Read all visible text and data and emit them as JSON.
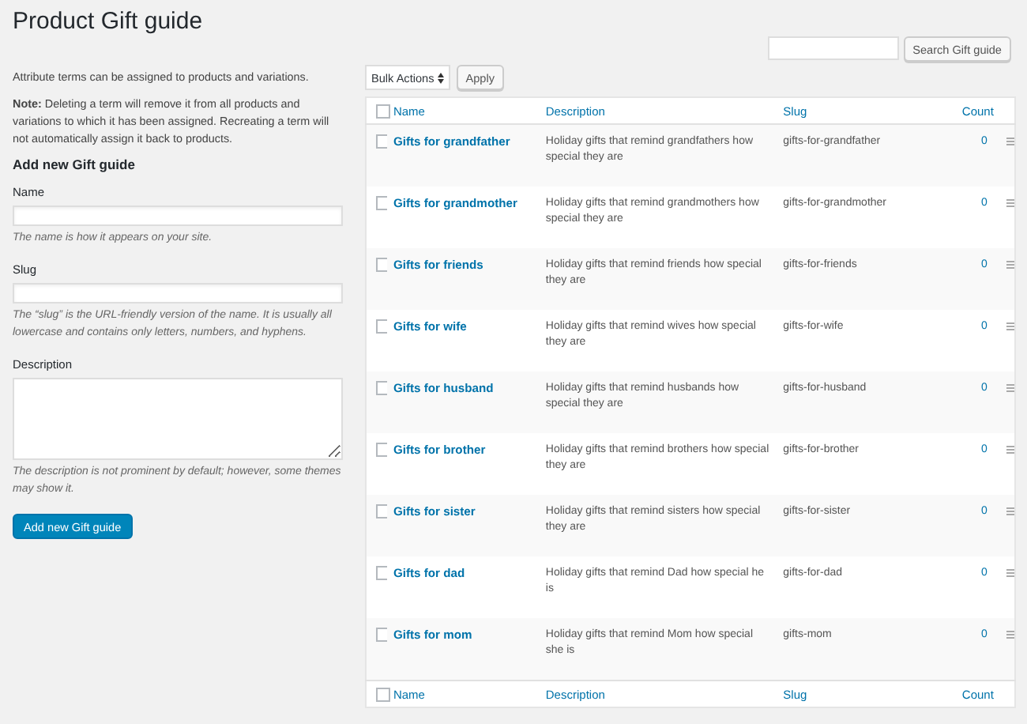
{
  "page_title": "Product Gift guide",
  "intro": "Attribute terms can be assigned to products and variations.",
  "note": "**Note:** Deleting a term will remove it from all products and variations to which it has been assigned. Recreating a term will not automatically assign it back to products.",
  "form": {
    "heading": "Add new Gift guide",
    "fields": [
      {
        "kind": "input",
        "label": "Name",
        "help": "The name is how it appears on your site."
      },
      {
        "kind": "input",
        "label": "Slug",
        "help": "The “slug” is the URL-friendly version of the name. It is usually all lowercase and contains only letters, numbers, and hyphens."
      },
      {
        "kind": "textarea",
        "label": "Description",
        "help": "The description is not prominent by default; however, some themes may show it."
      }
    ],
    "submit": "Add new Gift guide"
  },
  "search_button": "Search Gift guide",
  "bulk_actions": "Bulk Actions",
  "apply_button": "Apply",
  "table": {
    "columns": [
      "Name",
      "Description",
      "Slug",
      "Count"
    ],
    "select_all_checked": false,
    "rows": [
      {
        "checked": false,
        "name": "Gifts for grandfather",
        "description": "Holiday gifts that remind grandfathers how special they are",
        "slug": "gifts-for-grandfather",
        "count": "0"
      },
      {
        "checked": false,
        "name": "Gifts for grandmother",
        "description": "Holiday gifts that remind grandmothers how special they are",
        "slug": "gifts-for-grandmother",
        "count": "0"
      },
      {
        "checked": false,
        "name": "Gifts for friends",
        "description": "Holiday gifts that remind friends how special they are",
        "slug": "gifts-for-friends",
        "count": "0"
      },
      {
        "checked": false,
        "name": "Gifts for wife",
        "description": "Holiday gifts that remind wives how special they are",
        "slug": "gifts-for-wife",
        "count": "0"
      },
      {
        "checked": false,
        "name": "Gifts for husband",
        "description": "Holiday gifts that remind husbands how special they are",
        "slug": "gifts-for-husband",
        "count": "0"
      },
      {
        "checked": false,
        "name": "Gifts for brother",
        "description": "Holiday gifts that remind brothers how special they are",
        "slug": "gifts-for-brother",
        "count": "0"
      },
      {
        "checked": false,
        "name": "Gifts for sister",
        "description": "Holiday gifts that remind sisters how special they are",
        "slug": "gifts-for-sister",
        "count": "0"
      },
      {
        "checked": false,
        "name": "Gifts for dad",
        "description": "Holiday gifts that remind Dad how special he is",
        "slug": "gifts-for-dad",
        "count": "0"
      },
      {
        "checked": false,
        "name": "Gifts for mom",
        "description": "Holiday gifts that remind Mom how special she is",
        "slug": "gifts-mom",
        "count": "0"
      }
    ],
    "footer_columns": [
      "Name",
      "Description",
      "Slug",
      "Count"
    ],
    "footer_select_all_checked": false
  }
}
